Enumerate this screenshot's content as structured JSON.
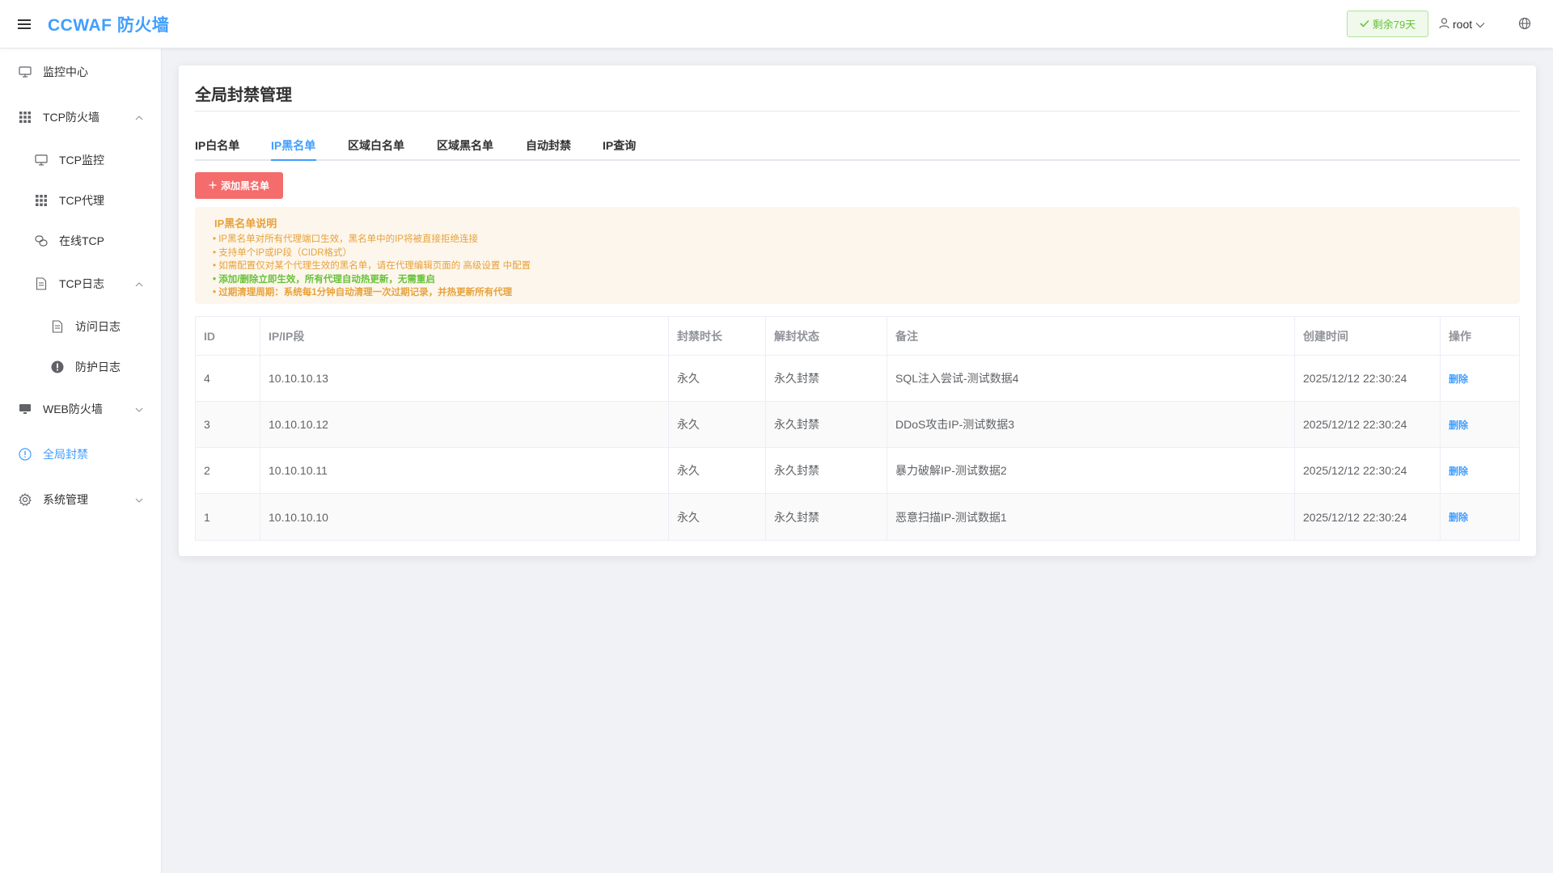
{
  "app": {
    "brand": "CCWAF 防火墙"
  },
  "header": {
    "trial_badge": "剩余79天",
    "user": "root"
  },
  "sidebar": {
    "items": [
      {
        "label": "监控中心",
        "icon": "monitor-icon"
      },
      {
        "label": "TCP防火墙",
        "icon": "grid-icon",
        "expanded": true
      },
      {
        "label": "TCP监控",
        "icon": "monitor-icon"
      },
      {
        "label": "TCP代理",
        "icon": "grid-icon"
      },
      {
        "label": "在线TCP",
        "icon": "link-icon"
      },
      {
        "label": "TCP日志",
        "icon": "document-icon",
        "expanded": true
      },
      {
        "label": "访问日志",
        "icon": "document-icon"
      },
      {
        "label": "防护日志",
        "icon": "warning-icon"
      },
      {
        "label": "WEB防火墙",
        "icon": "desktop-icon",
        "expanded": false
      },
      {
        "label": "全局封禁",
        "icon": "info-icon",
        "active": true
      },
      {
        "label": "系统管理",
        "icon": "gear-icon",
        "expanded": false
      }
    ]
  },
  "main": {
    "title": "全局封禁管理",
    "tabs": [
      {
        "label": "IP白名单"
      },
      {
        "label": "IP黑名单",
        "active": true
      },
      {
        "label": "区域白名单"
      },
      {
        "label": "区域黑名单"
      },
      {
        "label": "自动封禁"
      },
      {
        "label": "IP查询"
      }
    ],
    "add_button": "添加黑名单",
    "notice": {
      "title": "IP黑名单说明",
      "lines": [
        "• IP黑名单对所有代理端口生效，黑名单中的IP将被直接拒绝连接",
        "• 支持单个IP或IP段（CIDR格式）",
        "• 如需配置仅对某个代理生效的黑名单，请在代理编辑页面的 高级设置 中配置",
        "• 添加/删除立即生效，所有代理自动热更新，无需重启",
        "• 过期清理周期：系统每1分钟自动清理一次过期记录，并热更新所有代理"
      ]
    },
    "table": {
      "headers": [
        "ID",
        "IP/IP段",
        "封禁时长",
        "解封状态",
        "备注",
        "创建时间",
        "操作"
      ],
      "rows": [
        {
          "id": "4",
          "ip": "10.10.10.13",
          "duration": "永久",
          "status": "永久封禁",
          "remark": "SQL注入尝试-测试数据4",
          "created": "2025/12/12 22:30:24",
          "action": "删除"
        },
        {
          "id": "3",
          "ip": "10.10.10.12",
          "duration": "永久",
          "status": "永久封禁",
          "remark": "DDoS攻击IP-测试数据3",
          "created": "2025/12/12 22:30:24",
          "action": "删除"
        },
        {
          "id": "2",
          "ip": "10.10.10.11",
          "duration": "永久",
          "status": "永久封禁",
          "remark": "暴力破解IP-测试数据2",
          "created": "2025/12/12 22:30:24",
          "action": "删除"
        },
        {
          "id": "1",
          "ip": "10.10.10.10",
          "duration": "永久",
          "status": "永久封禁",
          "remark": "恶意扫描IP-测试数据1",
          "created": "2025/12/12 22:30:24",
          "action": "删除"
        }
      ]
    }
  },
  "colors": {
    "primary": "#409eff",
    "danger": "#f56c6c",
    "warning": "#e6a23c",
    "success": "#67c23a"
  }
}
